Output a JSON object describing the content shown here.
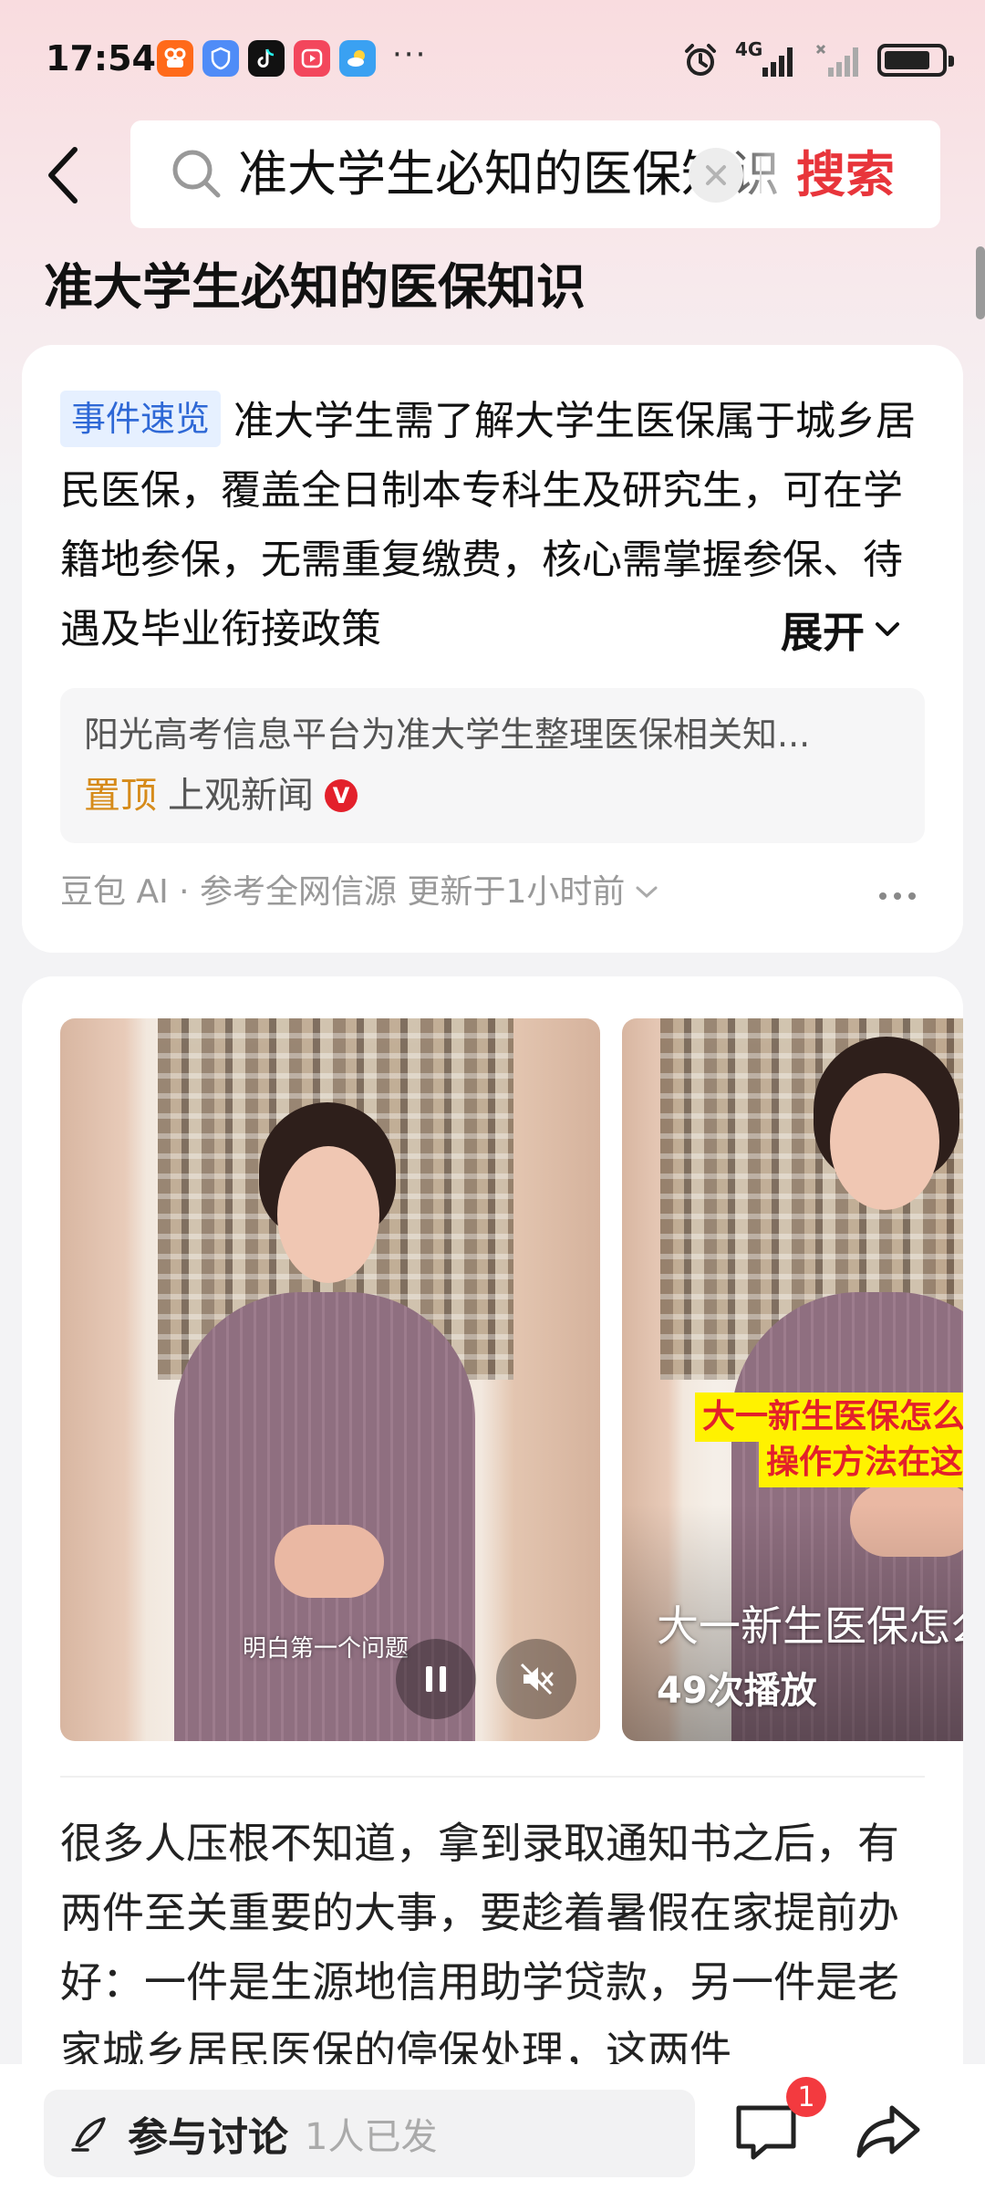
{
  "status_bar": {
    "time": "17:54",
    "dots": "···",
    "network_label": "4G",
    "icons": [
      "kuaishou-icon",
      "shield-app-icon",
      "tiktok-icon",
      "video-app-icon",
      "weather-icon",
      "alarm-icon",
      "signal-icon",
      "battery-icon"
    ],
    "battery_level": 0.72
  },
  "header": {
    "search_query": "准大学生必知的医保知识",
    "search_button": "搜索"
  },
  "page_title": "准大学生必知的医保知识",
  "summary": {
    "tag": "事件速览",
    "text": "准大学生需了解大学生医保属于城乡居民医保，覆盖全日制本专科生及研究生，可在学籍地参保，无需重复缴费，核心需掌握参保、待遇及毕业衔接政策",
    "expand_label": "展开",
    "source": {
      "title": "阳光高考信息平台为准大学生整理医保相关知...",
      "pin_label": "置顶",
      "name": "上观新闻",
      "verified": "V"
    },
    "footer": "豆包 AI · 参考全网信源 更新于1小时前"
  },
  "videos": [
    {
      "subtitle": "明白第一个问题"
    },
    {
      "overlay_line1": "大一新生医保怎么",
      "overlay_line2": "操作方法在这",
      "title": "大一新生医保怎么",
      "plays": "49次播放"
    }
  ],
  "article": {
    "text": "很多人压根不知道，拿到录取通知书之后，有两件至关重要的大事，要趁着暑假在家提前办好：一件是生源地信用助学贷款，另一件是老家城乡居民医保的停保处理，这两件"
  },
  "bottom_bar": {
    "discuss_label": "参与讨论",
    "discuss_count": "1人已发",
    "comment_badge": "1"
  },
  "colors": {
    "accent_red": "#e8353b",
    "tag_blue": "#2e68d6",
    "pin_orange": "#d68b1a"
  }
}
